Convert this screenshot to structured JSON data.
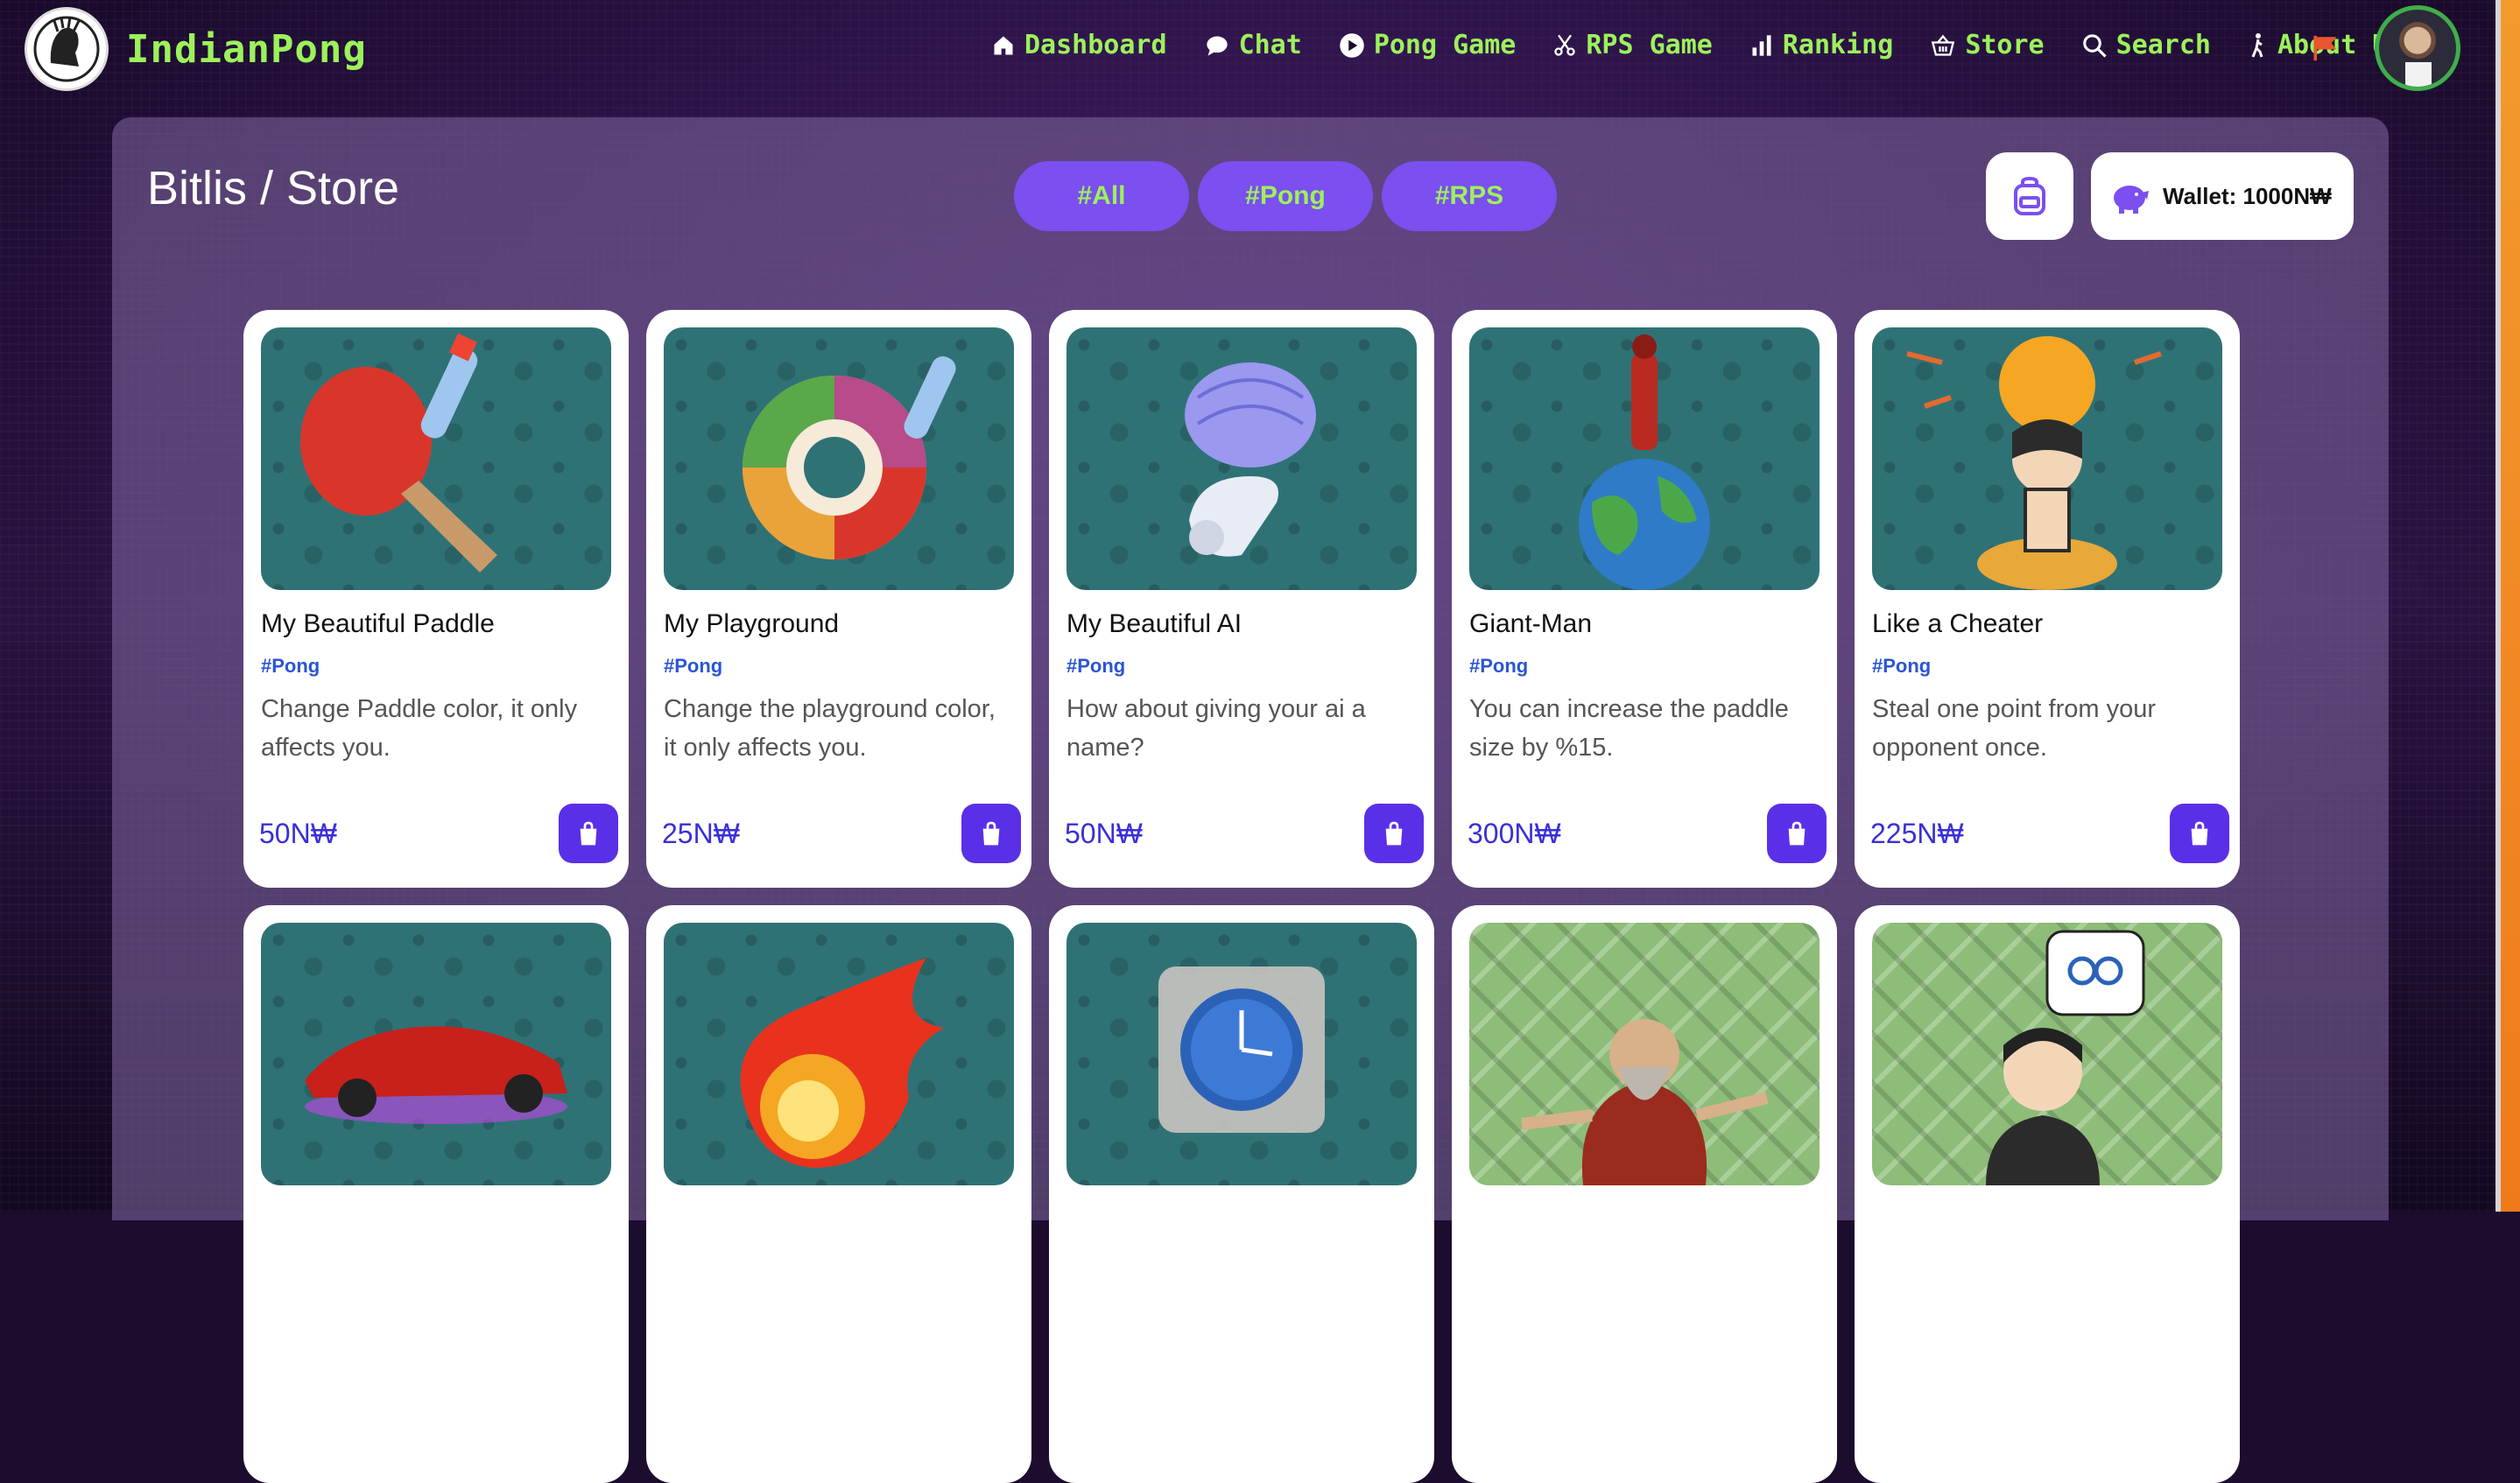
{
  "brand": {
    "name": "IndianPong"
  },
  "nav": {
    "items": [
      {
        "label": "Dashboard",
        "icon": "home-icon"
      },
      {
        "label": "Chat",
        "icon": "chat-icon"
      },
      {
        "label": "Pong Game",
        "icon": "play-icon"
      },
      {
        "label": "RPS Game",
        "icon": "scissors-icon"
      },
      {
        "label": "Ranking",
        "icon": "bar-chart-icon"
      },
      {
        "label": "Store",
        "icon": "basket-icon"
      },
      {
        "label": "Search",
        "icon": "search-icon"
      },
      {
        "label": "About Us",
        "icon": "person-walking-icon"
      }
    ],
    "flag_icon": "flag-icon",
    "accent_color": "#9cf25a"
  },
  "page": {
    "title": "Bitlis / Store"
  },
  "filters": [
    "#All",
    "#Pong",
    "#RPS"
  ],
  "wallet": {
    "label": "Wallet: 1000N₩",
    "icon": "piggy-bank-icon"
  },
  "cards": [
    {
      "title": "My Beautiful Paddle",
      "tag": "#Pong",
      "desc": "Change Paddle color, it only affects you.",
      "price": "50N₩",
      "image": "paddle-image"
    },
    {
      "title": "My Playground",
      "tag": "#Pong",
      "desc": "Change the playground color, it only affects you.",
      "price": "25N₩",
      "image": "color-wheel-image"
    },
    {
      "title": "My Beautiful AI",
      "tag": "#Pong",
      "desc": "How about giving your ai a name?",
      "price": "50N₩",
      "image": "robot-brain-image"
    },
    {
      "title": "Giant-Man",
      "tag": "#Pong",
      "desc": "You can increase the paddle size by %15.",
      "price": "300N₩",
      "image": "giant-man-image"
    },
    {
      "title": "Like a Cheater",
      "tag": "#Pong",
      "desc": "Steal one point from your opponent once.",
      "price": "225N₩",
      "image": "point-stealer-image"
    }
  ],
  "second_row": [
    {
      "image": "red-car-image"
    },
    {
      "image": "fireball-image"
    },
    {
      "image": "frozen-clock-image"
    },
    {
      "image": "god-figure-image"
    },
    {
      "image": "scissors-thinking-man-image"
    }
  ]
}
